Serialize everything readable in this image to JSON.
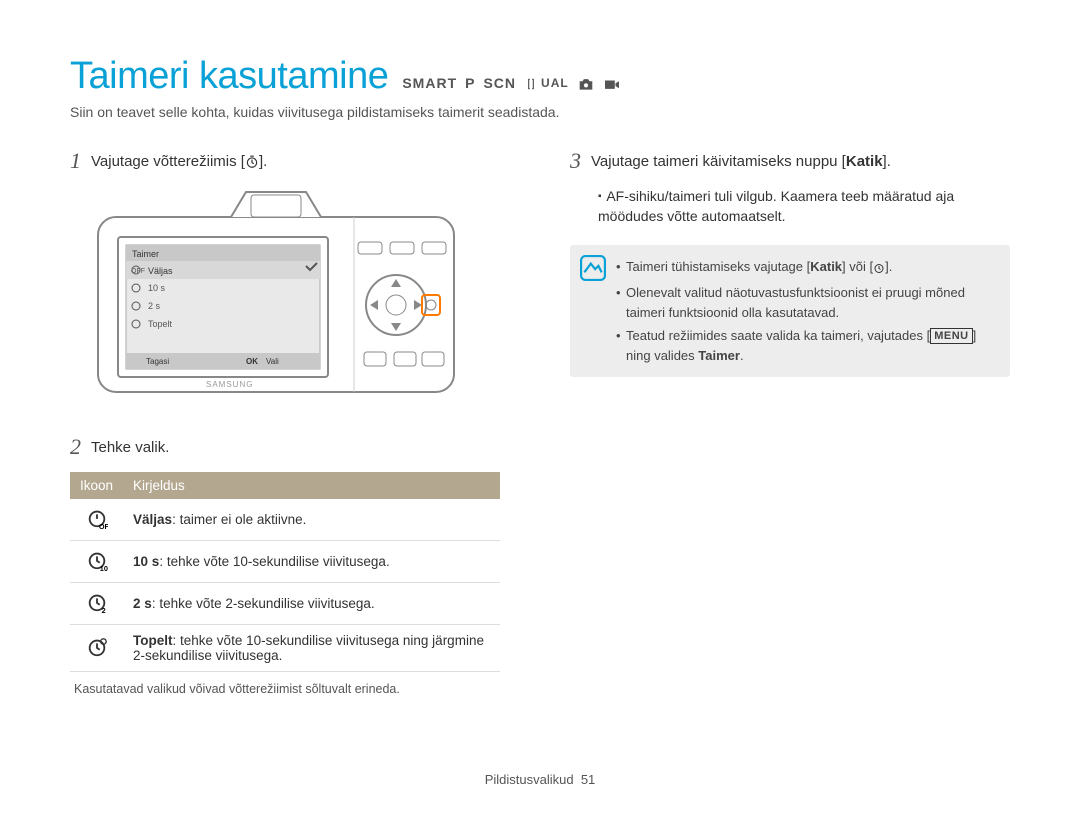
{
  "title": "Taimeri kasutamine",
  "mode_labels": {
    "smart": "SMART",
    "p": "P",
    "scn": "SCN",
    "dual": "UAL"
  },
  "intro": "Siin on teavet selle kohta, kuidas viivitusega pildistamiseks taimerit seadistada.",
  "steps": {
    "s1": {
      "num": "1",
      "text": "Vajutage võtterežiimis [",
      "text_after": "]."
    },
    "s2": {
      "num": "2",
      "text": "Tehke valik."
    },
    "s3": {
      "num": "3",
      "text_before": "Vajutage taimeri käivitamiseks nuppu [",
      "bold": "Katik",
      "text_after": "]."
    },
    "s3_sub": "AF-sihiku/taimeri tuli vilgub. Kaamera teeb määratud aja möödudes võtte automaatselt."
  },
  "camera_menu": {
    "title": "Taimer",
    "items": [
      "Väljas",
      "10 s",
      "2 s",
      "Topelt"
    ],
    "back": "Tagasi",
    "ok": "OK",
    "select": "Vali",
    "brand": "SAMSUNG"
  },
  "table": {
    "head_icon": "Ikoon",
    "head_desc": "Kirjeldus",
    "rows": [
      {
        "label": "Väljas",
        "desc": ": taimer ei ole aktiivne."
      },
      {
        "label": "10 s",
        "desc": ": tehke võte 10-sekundilise viivitusega."
      },
      {
        "label": "2 s",
        "desc": ": tehke võte 2-sekundilise viivitusega."
      },
      {
        "label": "Topelt",
        "desc": ": tehke võte 10-sekundilise viivitusega ning järgmine 2-sekundilise viivitusega."
      }
    ]
  },
  "footnote": "Kasutatavad valikud võivad võtterežiimist sõltuvalt erineda.",
  "note": {
    "li1_before": "Taimeri tühistamiseks vajutage [",
    "li1_bold": "Katik",
    "li1_mid": "] või [",
    "li1_after": "].",
    "li2": "Olenevalt valitud näotuvastusfunktsioonist ei pruugi mõned taimeri funktsioonid olla kasutatavad.",
    "li3_before": "Teatud režiimides saate valida ka taimeri, vajutades [",
    "li3_menu": "MENU",
    "li3_mid": "] ning valides ",
    "li3_bold": "Taimer",
    "li3_after": "."
  },
  "footer": {
    "section": "Pildistusvalikud",
    "page": "51"
  }
}
